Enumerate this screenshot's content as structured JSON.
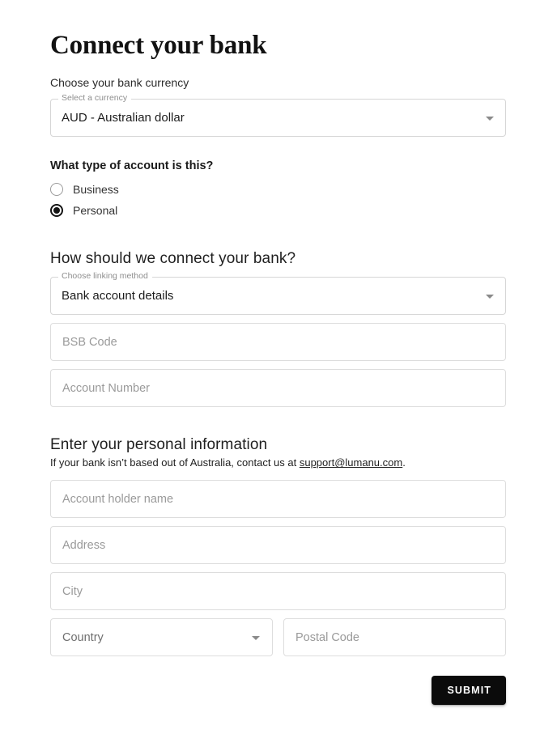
{
  "page": {
    "title": "Connect your bank",
    "background": "#ffffff",
    "accent": "#0b0b0b"
  },
  "currency_section": {
    "label": "Choose your bank currency",
    "select": {
      "float_label": "Select a currency",
      "value": "AUD - Australian dollar",
      "icon": "chevron-down-icon"
    }
  },
  "account_type_section": {
    "heading": "What type of account is this?",
    "options": [
      {
        "label": "Business",
        "selected": false
      },
      {
        "label": "Personal",
        "selected": true
      }
    ]
  },
  "linking_section": {
    "heading": "How should we connect your bank?",
    "select": {
      "float_label": "Choose linking method",
      "value": "Bank account details",
      "icon": "chevron-down-icon"
    },
    "fields": [
      {
        "placeholder": "BSB Code",
        "value": ""
      },
      {
        "placeholder": "Account Number",
        "value": ""
      }
    ]
  },
  "personal_section": {
    "heading": "Enter your personal information",
    "note_prefix": "If your bank isn’t based out of Australia, contact us at ",
    "note_link": "support@lumanu.com",
    "note_suffix": ".",
    "fields": [
      {
        "placeholder": "Account holder name",
        "value": ""
      },
      {
        "placeholder": "Address",
        "value": ""
      },
      {
        "placeholder": "City",
        "value": ""
      }
    ],
    "country": {
      "placeholder": "Country",
      "value": "",
      "icon": "chevron-down-icon"
    },
    "postal": {
      "placeholder": "Postal Code",
      "value": ""
    }
  },
  "footer": {
    "submit_label": "SUBMIT"
  }
}
